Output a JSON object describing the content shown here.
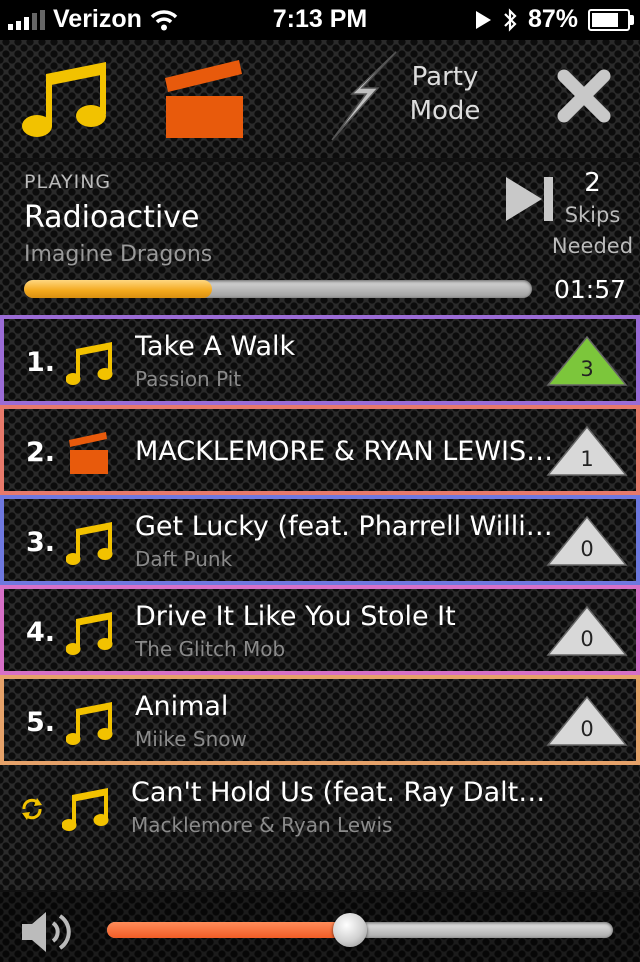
{
  "status_bar": {
    "carrier": "Verizon",
    "time": "7:13 PM",
    "battery": "87%",
    "battery_level": 0.87,
    "signal_bars": 3
  },
  "toolbar": {
    "music_icon": "music-note-icon",
    "video_icon": "clapperboard-icon",
    "party_icon": "lightning-icon",
    "party_line1": "Party",
    "party_line2": "Mode",
    "close_icon": "close-icon",
    "music_color": "#f2c200",
    "video_color": "#e85a0c"
  },
  "now_playing": {
    "label": "PLAYING",
    "title": "Radioactive",
    "artist": "Imagine Dragons",
    "skip_count": "2",
    "skips_label": "Skips",
    "needed_label": "Needed",
    "time": "01:57",
    "progress": 0.37
  },
  "queue": [
    {
      "number": "1.",
      "icon": "music-note-icon",
      "title": "Take A Walk",
      "artist": "Passion Pit",
      "votes": "3",
      "border_color": "#9b6cd6",
      "vote_color": "#7cc63b"
    },
    {
      "number": "2.",
      "icon": "clapperboard-icon",
      "title": "MACKLEMORE & RYAN LEWIS - CAN'T HOLD US",
      "artist": "",
      "votes": "1",
      "border_color": "#e7796b",
      "vote_color": "#d8d8d8"
    },
    {
      "number": "3.",
      "icon": "music-note-icon",
      "title": "Get Lucky (feat. Pharrell Williams)",
      "artist": "Daft Punk",
      "votes": "0",
      "border_color": "#6f78df",
      "vote_color": "#d8d8d8"
    },
    {
      "number": "4.",
      "icon": "music-note-icon",
      "title": "Drive It Like You Stole It",
      "artist": "The Glitch Mob",
      "votes": "0",
      "border_color": "#d770c7",
      "vote_color": "#d8d8d8"
    },
    {
      "number": "5.",
      "icon": "music-note-icon",
      "title": "Animal",
      "artist": "Miike Snow",
      "votes": "0",
      "border_color": "#e6a26a",
      "vote_color": "#d8d8d8"
    },
    {
      "number": "",
      "icon": "music-note-icon",
      "title": "Can't Hold Us (feat. Ray Dalton)",
      "artist": "Macklemore & Ryan Lewis",
      "votes": "",
      "border_color": "",
      "vote_color": ""
    }
  ],
  "volume": {
    "icon": "speaker-icon",
    "level": 0.48
  }
}
